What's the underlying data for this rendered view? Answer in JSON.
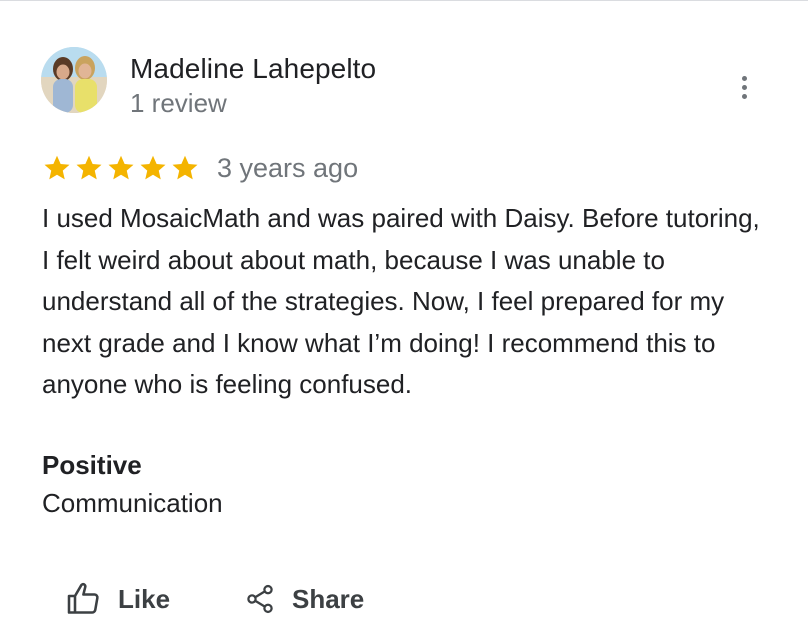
{
  "review": {
    "author_name": "Madeline Lahepelto",
    "author_review_count": "1 review",
    "rating": 5,
    "rating_max": 5,
    "date": "3 years ago",
    "text": "I used MosaicMath and was paired with Daisy. Before tutoring, I felt weird about about math, because I was unable to understand all of the strategies. Now, I feel prepared for my next grade and I know what I’m doing! I recommend this to anyone who is feeling confused.",
    "positive_label": "Positive",
    "positive_value": "Communication"
  },
  "actions": {
    "like_label": "Like",
    "share_label": "Share"
  },
  "icons": {
    "more": "more-vertical-icon",
    "star": "star-icon",
    "like": "thumbs-up-icon",
    "share": "share-icon"
  },
  "colors": {
    "star": "#f4b400",
    "secondary_text": "#70757a",
    "primary_text": "#202124"
  }
}
